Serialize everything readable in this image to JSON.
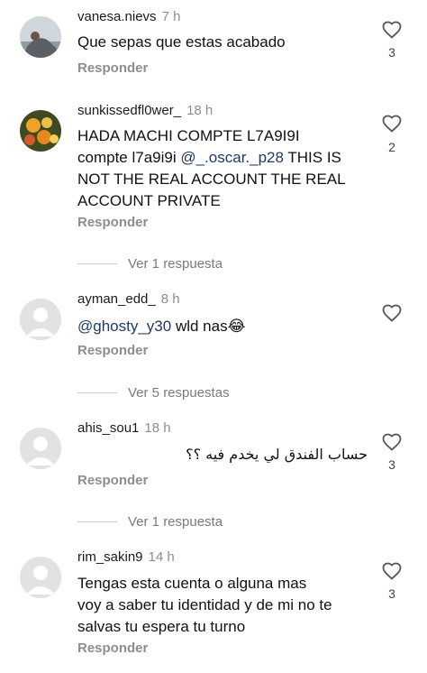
{
  "comments": [
    {
      "username": "vanesa.nievs",
      "time": "7 h",
      "text": "Que sepas que estas acabado",
      "likes": "3",
      "reply_label": "Responder"
    },
    {
      "username": "sunkissedfl0wer_",
      "time": "18 h",
      "text_line1": "HADA MACHI COMPTE L7A9I9I",
      "text_line2_pre": "compte l7a9i9i ",
      "mention": "@_.oscar._p28",
      "text_line2_post": "  THIS IS",
      "text_line3": "NOT THE REAL ACCOUNT THE REAL",
      "text_line4": "ACCOUNT PRIVATE",
      "likes": "2",
      "reply_label": "Responder",
      "view_replies": "Ver 1 respuesta"
    },
    {
      "username": "ayman_edd_",
      "time": "8 h",
      "mention": "@ghosty_y30",
      "text_post": " wld nas😂",
      "reply_label": "Responder",
      "view_replies": "Ver 5 respuestas"
    },
    {
      "username": "ahis_sou1",
      "time": "18 h",
      "text": "حساب الفندق لي يخدم فيه ؟؟",
      "likes": "3",
      "reply_label": "Responder",
      "view_replies": "Ver 1 respuesta"
    },
    {
      "username": "rim_sakin9",
      "time": "14 h",
      "text_line1": "Tengas esta cuenta o alguna mas",
      "text_line2": "voy a saber tu identidad y de mi no te",
      "text_line3": "salvas tu espera tu turno",
      "likes": "3",
      "reply_label": "Responder"
    }
  ],
  "icons": {
    "like": "heart-outline-icon",
    "avatar_default": "default-user-icon"
  },
  "colors": {
    "mention": "#1f3a66",
    "muted": "#8e8e8e"
  }
}
